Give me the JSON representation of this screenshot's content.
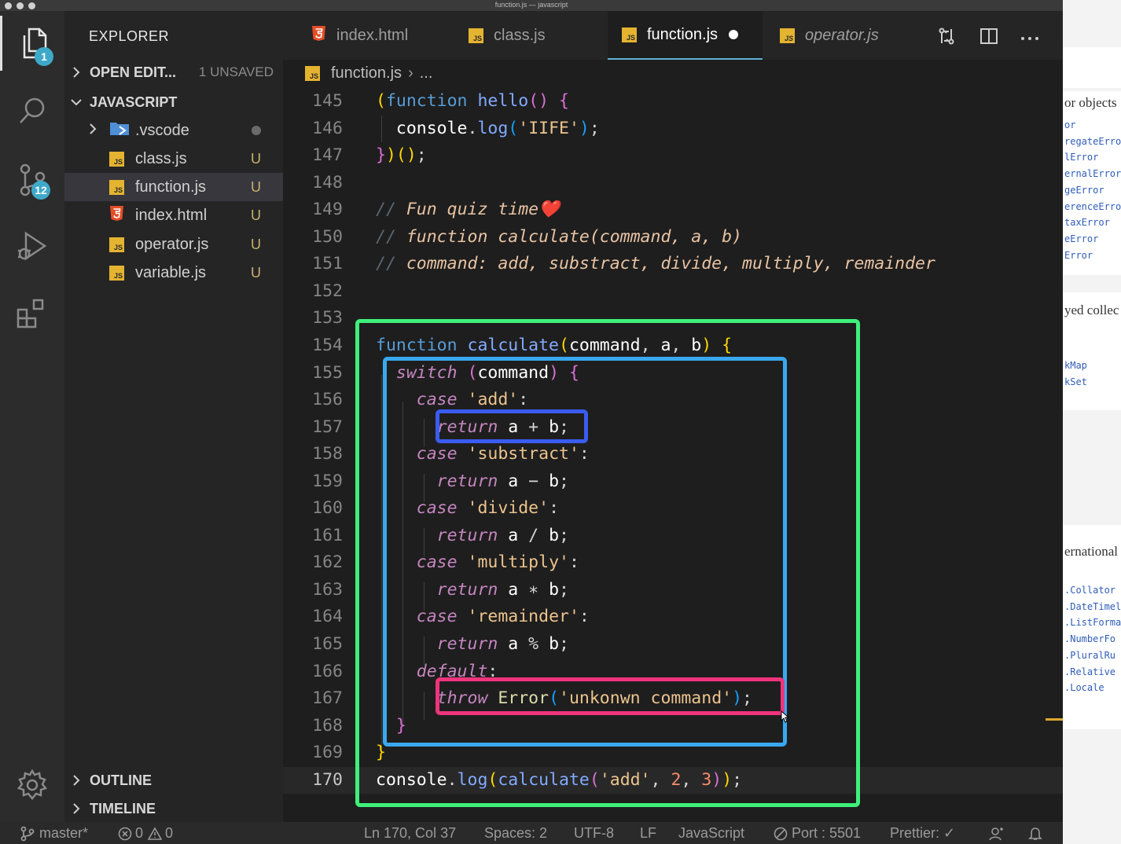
{
  "window": {
    "title": "function.js — javascript"
  },
  "activity_bar": {
    "explorer_badge": "1",
    "source_control_badge": "12"
  },
  "sidebar": {
    "title": "EXPLORER",
    "open_editors": {
      "label": "OPEN EDIT...",
      "status": "1 UNSAVED"
    },
    "project": {
      "label": "JAVASCRIPT"
    },
    "files": [
      {
        "name": ".vscode",
        "status": ""
      },
      {
        "name": "class.js",
        "status": "U"
      },
      {
        "name": "function.js",
        "status": "U"
      },
      {
        "name": "index.html",
        "status": "U"
      },
      {
        "name": "operator.js",
        "status": "U"
      },
      {
        "name": "variable.js",
        "status": "U"
      }
    ],
    "outline_label": "OUTLINE",
    "timeline_label": "TIMELINE"
  },
  "tabs": [
    {
      "label": "index.html"
    },
    {
      "label": "class.js"
    },
    {
      "label": "function.js"
    },
    {
      "label": "operator.js"
    }
  ],
  "breadcrumb": {
    "file": "function.js",
    "rest": "..."
  },
  "editor": {
    "lines": [
      {
        "num": "145",
        "tokens": [
          [
            "p1",
            "("
          ],
          [
            "kw",
            "function "
          ],
          [
            "fnb",
            "hello"
          ],
          [
            "p2",
            "() "
          ],
          [
            "p2",
            "{"
          ]
        ]
      },
      {
        "num": "146",
        "tokens": [
          [
            "op",
            "  "
          ],
          [
            "var",
            "console"
          ],
          [
            "op",
            "."
          ],
          [
            "fnb",
            "log"
          ],
          [
            "p3",
            "("
          ],
          [
            "str",
            "'IIFE'"
          ],
          [
            "p3",
            ")"
          ],
          [
            "op",
            ";"
          ]
        ]
      },
      {
        "num": "147",
        "tokens": [
          [
            "p2",
            "}"
          ],
          [
            "p1",
            ")"
          ],
          [
            "p1",
            "()"
          ],
          [
            "op",
            ";"
          ]
        ]
      },
      {
        "num": "148",
        "tokens": []
      },
      {
        "num": "149",
        "tokens": [
          [
            "cmm",
            "// "
          ],
          [
            "cm",
            "Fun quiz time❤️"
          ]
        ]
      },
      {
        "num": "150",
        "tokens": [
          [
            "cmm",
            "// "
          ],
          [
            "cm",
            "function calculate(command, a, b)"
          ]
        ]
      },
      {
        "num": "151",
        "tokens": [
          [
            "cmm",
            "// "
          ],
          [
            "cm",
            "command: add, substract, divide, multiply, remainder"
          ]
        ]
      },
      {
        "num": "152",
        "tokens": []
      },
      {
        "num": "153",
        "tokens": []
      },
      {
        "num": "154",
        "tokens": [
          [
            "kw",
            "function "
          ],
          [
            "fnb",
            "calculate"
          ],
          [
            "p1",
            "("
          ],
          [
            "var",
            "command"
          ],
          [
            "op",
            ", "
          ],
          [
            "var",
            "a"
          ],
          [
            "op",
            ", "
          ],
          [
            "var",
            "b"
          ],
          [
            "p1",
            ") "
          ],
          [
            "p1",
            "{"
          ]
        ]
      },
      {
        "num": "155",
        "tokens": [
          [
            "op",
            "  "
          ],
          [
            "ctl",
            "switch "
          ],
          [
            "p2",
            "("
          ],
          [
            "var",
            "command"
          ],
          [
            "p2",
            ") "
          ],
          [
            "p2",
            "{"
          ]
        ]
      },
      {
        "num": "156",
        "tokens": [
          [
            "op",
            "    "
          ],
          [
            "ctl",
            "case "
          ],
          [
            "str",
            "'add'"
          ],
          [
            "op",
            ":"
          ]
        ]
      },
      {
        "num": "157",
        "tokens": [
          [
            "op",
            "      "
          ],
          [
            "ctl",
            "return "
          ],
          [
            "var",
            "a"
          ],
          [
            "op",
            " + "
          ],
          [
            "var",
            "b"
          ],
          [
            "op",
            ";"
          ]
        ]
      },
      {
        "num": "158",
        "tokens": [
          [
            "op",
            "    "
          ],
          [
            "ctl",
            "case "
          ],
          [
            "str",
            "'substract'"
          ],
          [
            "op",
            ":"
          ]
        ]
      },
      {
        "num": "159",
        "tokens": [
          [
            "op",
            "      "
          ],
          [
            "ctl",
            "return "
          ],
          [
            "var",
            "a"
          ],
          [
            "op",
            " − "
          ],
          [
            "var",
            "b"
          ],
          [
            "op",
            ";"
          ]
        ]
      },
      {
        "num": "160",
        "tokens": [
          [
            "op",
            "    "
          ],
          [
            "ctl",
            "case "
          ],
          [
            "str",
            "'divide'"
          ],
          [
            "op",
            ":"
          ]
        ]
      },
      {
        "num": "161",
        "tokens": [
          [
            "op",
            "      "
          ],
          [
            "ctl",
            "return "
          ],
          [
            "var",
            "a"
          ],
          [
            "op",
            " / "
          ],
          [
            "var",
            "b"
          ],
          [
            "op",
            ";"
          ]
        ]
      },
      {
        "num": "162",
        "tokens": [
          [
            "op",
            "    "
          ],
          [
            "ctl",
            "case "
          ],
          [
            "str",
            "'multiply'"
          ],
          [
            "op",
            ":"
          ]
        ]
      },
      {
        "num": "163",
        "tokens": [
          [
            "op",
            "      "
          ],
          [
            "ctl",
            "return "
          ],
          [
            "var",
            "a"
          ],
          [
            "op",
            " ∗ "
          ],
          [
            "var",
            "b"
          ],
          [
            "op",
            ";"
          ]
        ]
      },
      {
        "num": "164",
        "tokens": [
          [
            "op",
            "    "
          ],
          [
            "ctl",
            "case "
          ],
          [
            "str",
            "'remainder'"
          ],
          [
            "op",
            ":"
          ]
        ]
      },
      {
        "num": "165",
        "tokens": [
          [
            "op",
            "      "
          ],
          [
            "ctl",
            "return "
          ],
          [
            "var",
            "a"
          ],
          [
            "op",
            " % "
          ],
          [
            "var",
            "b"
          ],
          [
            "op",
            ";"
          ]
        ]
      },
      {
        "num": "166",
        "tokens": [
          [
            "op",
            "    "
          ],
          [
            "ctl",
            "default"
          ],
          [
            "op",
            ":"
          ]
        ]
      },
      {
        "num": "167",
        "tokens": [
          [
            "op",
            "      "
          ],
          [
            "ctl",
            "throw "
          ],
          [
            "fn",
            "Error"
          ],
          [
            "p3",
            "("
          ],
          [
            "str",
            "'unkonwn command'"
          ],
          [
            "p3",
            ")"
          ],
          [
            "op",
            ";"
          ]
        ]
      },
      {
        "num": "168",
        "tokens": [
          [
            "op",
            "  "
          ],
          [
            "p2",
            "}"
          ]
        ]
      },
      {
        "num": "169",
        "tokens": [
          [
            "p1",
            "}"
          ]
        ]
      },
      {
        "num": "170",
        "tokens": [
          [
            "var",
            "console"
          ],
          [
            "op",
            "."
          ],
          [
            "fnb",
            "log"
          ],
          [
            "p1",
            "("
          ],
          [
            "fnb",
            "calculate"
          ],
          [
            "p2",
            "("
          ],
          [
            "str",
            "'add'"
          ],
          [
            "op",
            ", "
          ],
          [
            "num",
            "2"
          ],
          [
            "op",
            ", "
          ],
          [
            "num",
            "3"
          ],
          [
            "p2",
            ")"
          ],
          [
            "p1",
            ")"
          ],
          [
            "op",
            ";"
          ]
        ]
      }
    ],
    "current_line": "170"
  },
  "right_panel": {
    "heading1": "or objects",
    "group1": [
      "or",
      "regateErro",
      "lError",
      "ernalError",
      "geError",
      "erenceErro",
      "taxError",
      "eError",
      "Error"
    ],
    "heading2": "yed collec",
    "group2": [
      "kMap",
      "kSet"
    ],
    "heading3": "ernational",
    "group3": [
      ".Collator",
      ".DateTimel",
      ".ListForma",
      ".NumberFo",
      ".PluralRu",
      ".Relative",
      ".Locale"
    ]
  },
  "status_bar": {
    "branch": "master*",
    "errors": "0",
    "warnings": "0",
    "position": "Ln 170, Col 37",
    "spaces": "Spaces: 2",
    "encoding": "UTF-8",
    "eol": "LF",
    "language": "JavaScript",
    "port": "Port : 5501",
    "prettier": "Prettier: ✓"
  },
  "colors": {
    "highlight_green": "#3ef07a",
    "highlight_lightblue": "#3aa8f0",
    "highlight_blue": "#3a5cf0",
    "highlight_pink": "#f0347c"
  }
}
